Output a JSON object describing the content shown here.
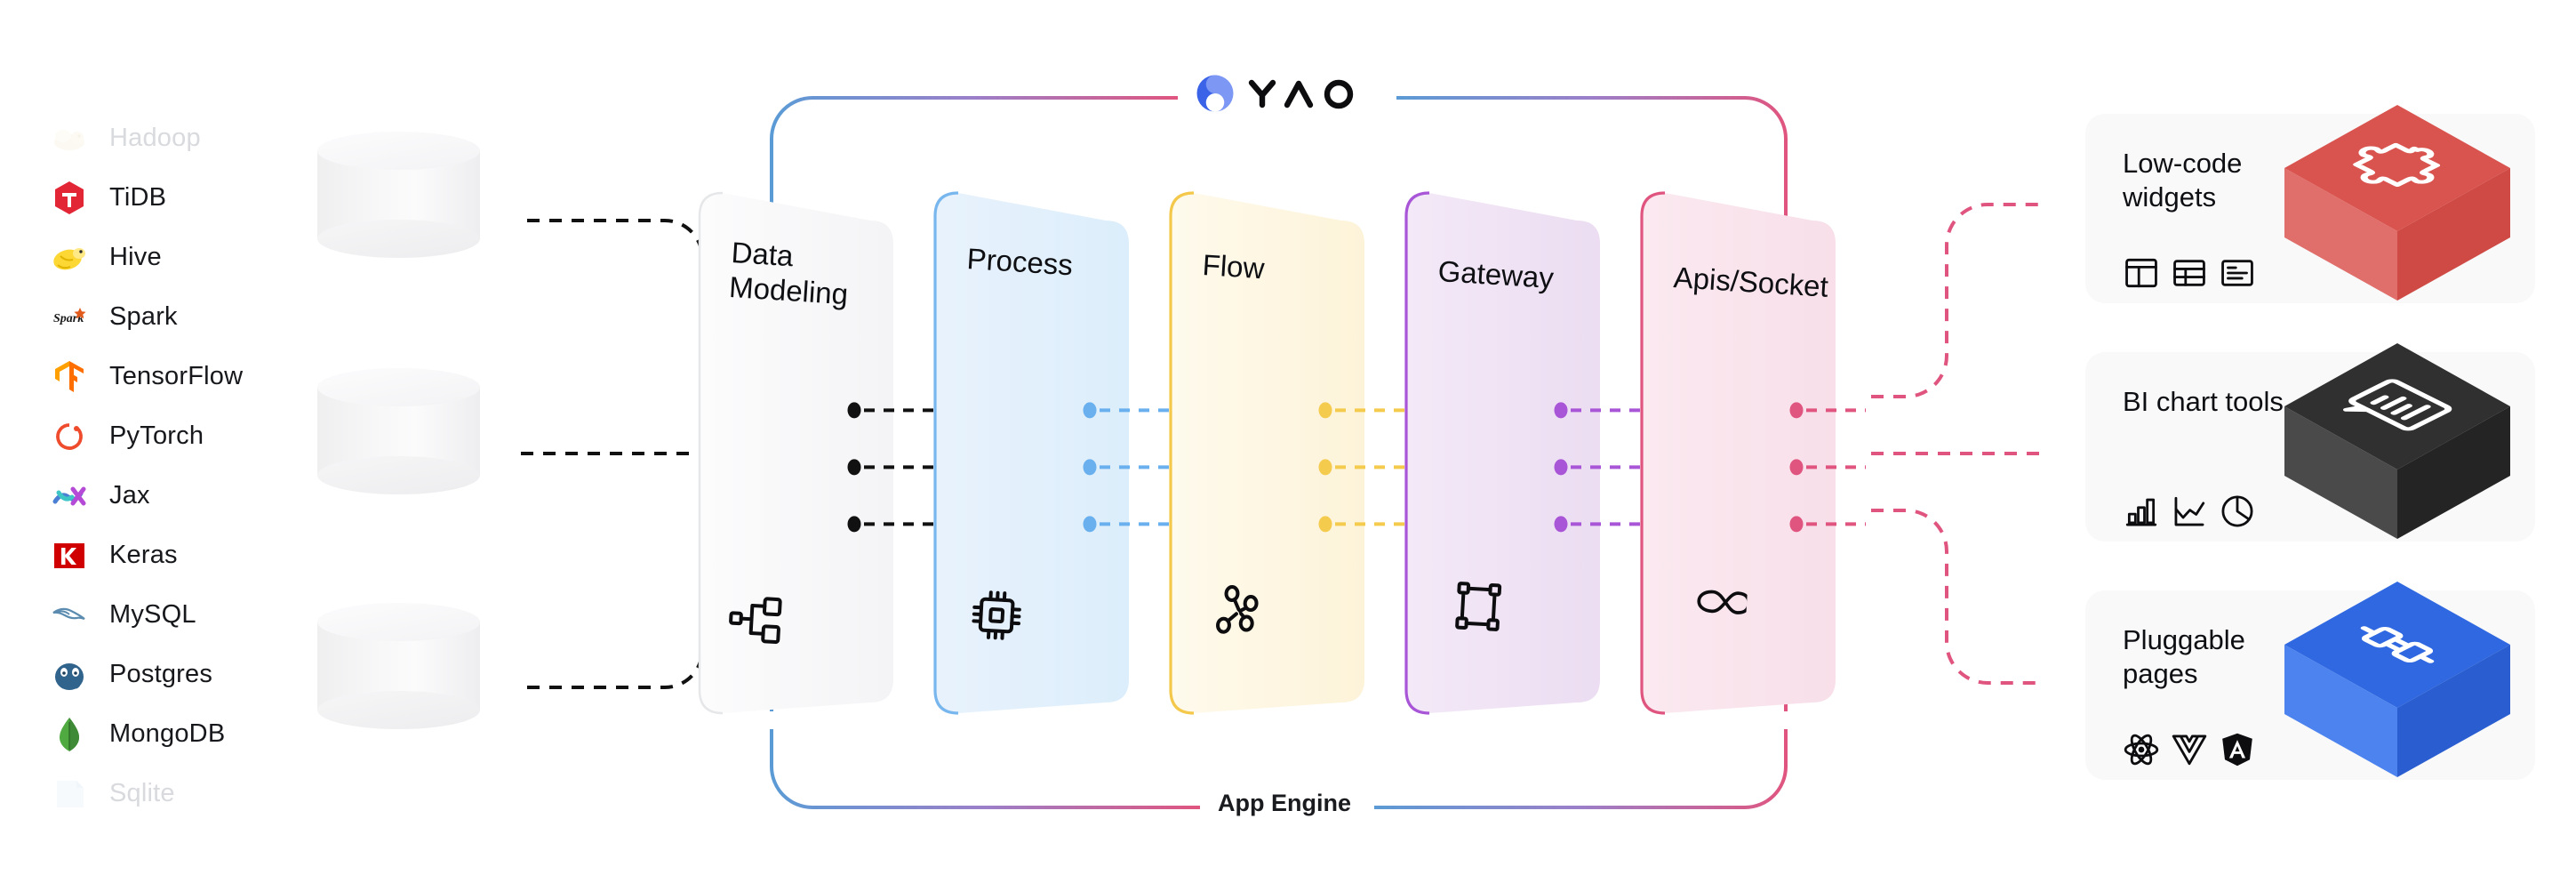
{
  "brand": {
    "logo_name": "yao-logo",
    "wordmark": "YAO",
    "logo_blue_dark": "#3b63e8",
    "logo_blue_light": "#7d97f5"
  },
  "tech_stack": {
    "items": [
      {
        "label": "Hadoop",
        "icon": "hadoop-icon",
        "dimmed": true,
        "color": "#f9f2d8"
      },
      {
        "label": "TiDB",
        "icon": "tidb-icon",
        "dimmed": false,
        "color": "#e32636"
      },
      {
        "label": "Hive",
        "icon": "hive-icon",
        "dimmed": false,
        "color": "#fdd835"
      },
      {
        "label": "Spark",
        "icon": "spark-icon",
        "dimmed": false,
        "color": "#e25a1c"
      },
      {
        "label": "TensorFlow",
        "icon": "tensorflow-icon",
        "dimmed": false,
        "color": "#ff6f00"
      },
      {
        "label": "PyTorch",
        "icon": "pytorch-icon",
        "dimmed": false,
        "color": "#ee4c2c"
      },
      {
        "label": "Jax",
        "icon": "jax-icon",
        "dimmed": false,
        "color": "#8b5cf6"
      },
      {
        "label": "Keras",
        "icon": "keras-icon",
        "dimmed": false,
        "color": "#d00000"
      },
      {
        "label": "MySQL",
        "icon": "mysql-icon",
        "dimmed": false,
        "color": "#5b8cb0"
      },
      {
        "label": "Postgres",
        "icon": "postgres-icon",
        "dimmed": false,
        "color": "#31648c"
      },
      {
        "label": "MongoDB",
        "icon": "mongodb-icon",
        "dimmed": false,
        "color": "#4faa41"
      },
      {
        "label": "Sqlite",
        "icon": "sqlite-icon",
        "dimmed": true,
        "color": "#d8e6f2"
      }
    ]
  },
  "databases": {
    "count": 3,
    "shape": "cylinder"
  },
  "engine": {
    "bracket_label": "App Engine",
    "bracket_start_color": "#5b9bd5",
    "bracket_end_color": "#e0557f",
    "panels": [
      {
        "label": "Data Modeling",
        "icon": "hierarchy-icon",
        "fill": "#f8f8f9",
        "stroke": "#e6e7e9",
        "dot": "#111111",
        "dash": "#111111"
      },
      {
        "label": "Process",
        "icon": "cpu-chip-icon",
        "fill": "#e3f0fb",
        "stroke": "#78b6ee",
        "dot": "#6ab0ef",
        "dash": "#6ab0ef"
      },
      {
        "label": "Flow",
        "icon": "share-nodes-icon",
        "fill": "#fdf6e1",
        "stroke": "#f3c84b",
        "dot": "#f5cb4d",
        "dash": "#f5cb4d"
      },
      {
        "label": "Gateway",
        "icon": "artboard-frame-icon",
        "fill": "#efe4f4",
        "stroke": "#a855d8",
        "dot": "#a855d8",
        "dash": "#a855d8"
      },
      {
        "label": "Apis/Socket",
        "icon": "infinity-icon",
        "fill": "#f9e4ec",
        "stroke": "#e0557f",
        "dot": "#e0557f",
        "dash": "#e0557f"
      }
    ]
  },
  "outputs": {
    "cards": [
      {
        "title": "Low-code widgets",
        "box_color": "#d9544f",
        "box_color_light": "#e06e6a",
        "box_color_dark": "#cf4a45",
        "box_icon": "puzzle-piece-icon",
        "icons": [
          {
            "name": "layout-panels-icon"
          },
          {
            "name": "table-grid-icon"
          },
          {
            "name": "form-list-icon"
          }
        ]
      },
      {
        "title": "BI chart tools",
        "box_color": "#303030",
        "box_color_light": "#4a4a4a",
        "box_color_dark": "#242424",
        "box_icon": "chart-note-icon",
        "icons": [
          {
            "name": "bar-chart-icon"
          },
          {
            "name": "line-chart-icon"
          },
          {
            "name": "pie-chart-icon"
          }
        ]
      },
      {
        "title": "Pluggable pages",
        "box_color": "#2f68e0",
        "box_color_light": "#4d83ef",
        "box_color_dark": "#2a5ed0",
        "box_icon": "plug-connector-icon",
        "icons": [
          {
            "name": "react-icon"
          },
          {
            "name": "vue-icon"
          },
          {
            "name": "angular-icon"
          }
        ]
      }
    ]
  }
}
